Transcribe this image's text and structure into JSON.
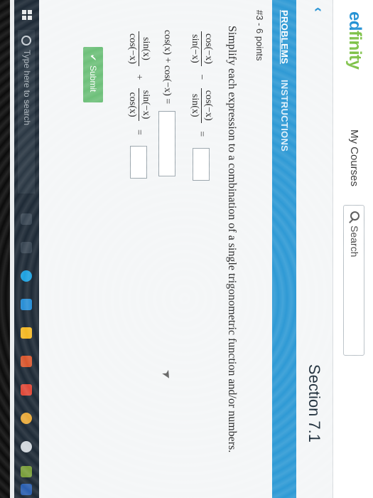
{
  "header": {
    "logo_main": "ed",
    "logo_accent": "finity",
    "my_courses": "My Courses",
    "search_label": "Search"
  },
  "section": {
    "title": "Section 7.1"
  },
  "tabs": [
    {
      "label": "PROBLEMS"
    },
    {
      "label": "INSTRUCTIONS"
    }
  ],
  "problem": {
    "number_points": "#3 - 6 points",
    "prompt": "Simplify each expression to a combination of a single trigonometric function and/or numbers.",
    "row1": {
      "f1_num": "cos(−x)",
      "f1_den": "sin(−x)",
      "op": "−",
      "f2_num": "cos(−x)",
      "f2_den": "sin(x)",
      "eq": "="
    },
    "row2": {
      "expr": "cos(x) + cos(−x) ="
    },
    "row3": {
      "f1_num": "sin(x)",
      "f1_den": "cos(−x)",
      "op": "+",
      "f2_num": "sin(−x)",
      "f2_den": "cos(x)",
      "eq": "="
    }
  },
  "submit": {
    "label": "Submit"
  },
  "taskbar": {
    "search_placeholder": "Type here to search"
  },
  "colors": {
    "accent_blue": "#2f9ad5",
    "logo_blue": "#1f8fd3",
    "logo_green": "#7bc043",
    "submit_green": "#6ec07a"
  }
}
